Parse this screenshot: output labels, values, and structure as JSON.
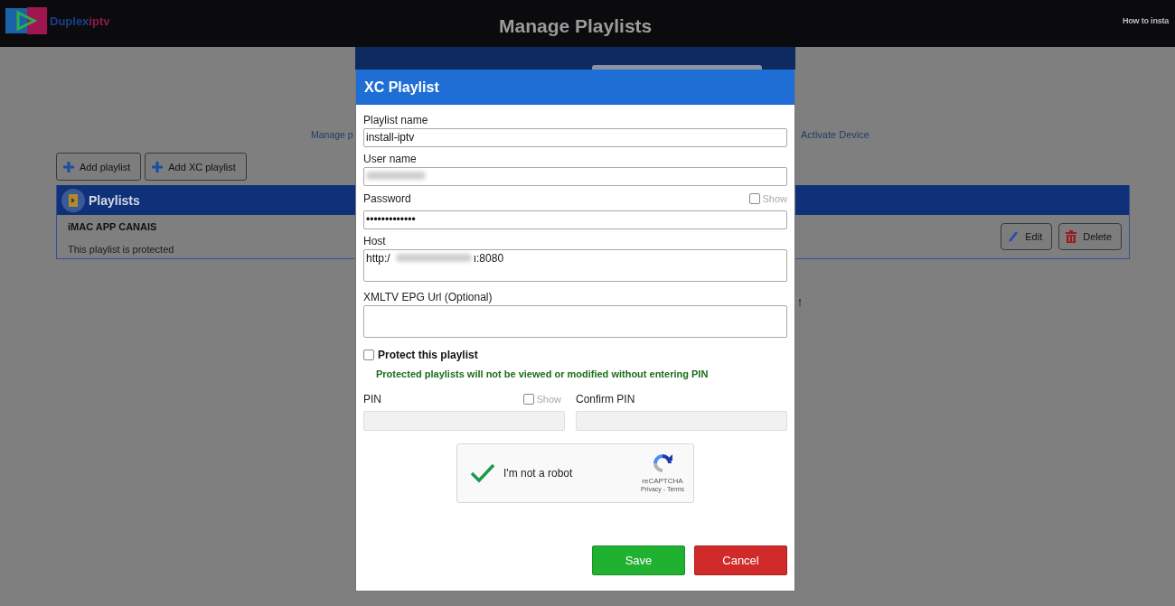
{
  "header": {
    "brand": [
      "Duplex",
      "iptv"
    ],
    "title": "Manage Playlists",
    "link": "How to insta"
  },
  "page": {
    "links": [
      "Manage p",
      "Activate Device"
    ],
    "toolbar": [
      {
        "label": "Add playlist"
      },
      {
        "label": "Add XC playlist"
      }
    ],
    "panel_title": "Playlists",
    "playlists": [
      {
        "name": "iMAC APP CANAIS",
        "note": "This playlist is protected",
        "actions": [
          {
            "kind": "edit",
            "label": "Edit"
          },
          {
            "kind": "delete",
            "label": "Delete"
          }
        ]
      }
    ],
    "message_tail": "!"
  },
  "dialog": {
    "title": "XC Playlist",
    "fields": [
      {
        "kind": "input",
        "label": "Playlist name",
        "value": "install-iptv"
      },
      {
        "kind": "input",
        "label": "User name",
        "redacted": true
      },
      {
        "kind": "input",
        "label": "Password",
        "value": "•••••••••••••",
        "show": {
          "label": "Show",
          "checked": false
        }
      },
      {
        "kind": "textarea",
        "label": "Host",
        "value": "http:/",
        "value_end": "ı:8080",
        "redacted": true
      },
      {
        "kind": "textarea",
        "label": "XMLTV EPG Url (Optional)"
      }
    ],
    "protect": {
      "label": "Protect this playlist",
      "checked": false,
      "note": "Protected playlists will not be viewed or modified without entering PIN"
    },
    "pin": [
      {
        "label": "PIN",
        "disabled": true,
        "show": {
          "label": "Show",
          "checked": false
        }
      },
      {
        "label": "Confirm PIN",
        "disabled": true
      }
    ],
    "captcha": {
      "label": "I'm not a robot",
      "checked": true,
      "brand": "reCAPTCHA",
      "links": "Privacy - Terms"
    },
    "buttons": [
      {
        "kind": "primary",
        "label": "Save"
      },
      {
        "kind": "danger",
        "label": "Cancel"
      }
    ]
  }
}
